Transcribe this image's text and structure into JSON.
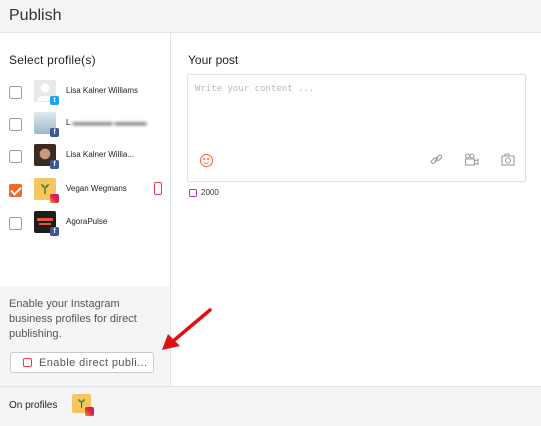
{
  "header": {
    "title": "Publish"
  },
  "sidebar": {
    "heading": "Select profile(s)",
    "profiles": [
      {
        "name": "Lisa Kalner Williams",
        "network": "twitter",
        "checked": false
      },
      {
        "name": "L                ",
        "network": "facebook",
        "checked": false,
        "blurred": true
      },
      {
        "name": "Lisa Kalner Willia...",
        "network": "facebook",
        "checked": false
      },
      {
        "name": "Vegan Wegmans",
        "network": "instagram",
        "checked": true,
        "icon": "mobile-phone-icon"
      },
      {
        "name": "AgoraPulse",
        "network": "facebook",
        "checked": false
      }
    ],
    "promo": {
      "text": "Enable your Instagram business profiles for direct publishing.",
      "button_label": "Enable direct publi..."
    }
  },
  "post": {
    "heading": "Your post",
    "placeholder": "Write your content ...",
    "char_count": "2000",
    "icons": [
      "emoji-icon",
      "link-icon",
      "video-icon",
      "camera-icon"
    ]
  },
  "footer": {
    "label": "On profiles"
  },
  "colors": {
    "accent": "#f26a2b",
    "instagram": "#e8395a",
    "annotation_arrow": "#e01010"
  }
}
